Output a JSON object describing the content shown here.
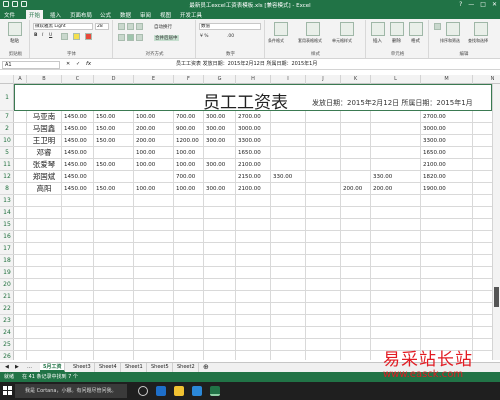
{
  "window": {
    "title": "最新员工excel工资表模板.xls  [兼容模式] - Excel",
    "controls": [
      "?",
      "—",
      "□",
      "✕"
    ]
  },
  "ribbon_tabs": [
    "文件",
    "开始",
    "插入",
    "页面布局",
    "公式",
    "数据",
    "审阅",
    "视图",
    "开发工具"
  ],
  "ribbon": {
    "paste_label": "粘贴",
    "font_name": "微软雅黑 Light",
    "font_size": "28",
    "wrap_text": "自动换行",
    "merge_center": "合并后居中",
    "number_format": "数值",
    "conditional_format": "条件格式",
    "table_format": "套用表格格式",
    "cell_style": "单元格样式",
    "insert": "插入",
    "delete": "删除",
    "format": "格式",
    "sort_filter": "排序和筛选",
    "find_select": "查找和选择",
    "group_clipboard": "剪贴板",
    "group_font": "字体",
    "group_alignment": "对齐方式",
    "group_number": "数字",
    "group_styles": "样式",
    "group_cells": "单元格",
    "group_editing": "编辑"
  },
  "formula_bar": {
    "name_box": "A1",
    "fx": "fx",
    "content": "员工工资表    发放日期：2015年2月12日  所属日期：2015年1月"
  },
  "columns": [
    "A",
    "B",
    "C",
    "D",
    "E",
    "F",
    "G",
    "H",
    "I",
    "J",
    "K",
    "L",
    "M",
    "N"
  ],
  "rows": [
    "1",
    "7",
    "2",
    "10",
    "5",
    "11",
    "12",
    "8",
    "13",
    "14",
    "15",
    "16",
    "17",
    "18",
    "19",
    "20",
    "21",
    "22",
    "23",
    "24",
    "25",
    "26"
  ],
  "sheet_title": {
    "title": "员工工资表",
    "subtitle": "发放日期：2015年2月12日  所属日期：2015年1月"
  },
  "table": [
    {
      "name": "马亚南",
      "c": "1450.00",
      "d": "150.00",
      "e": "100.00",
      "f": "700.00",
      "g": "300.00",
      "h": "2700.00",
      "i": "",
      "j": "",
      "k": "",
      "l": "",
      "m": "2700.00"
    },
    {
      "name": "马国鑫",
      "c": "1450.00",
      "d": "150.00",
      "e": "200.00",
      "f": "900.00",
      "g": "300.00",
      "h": "3000.00",
      "i": "",
      "j": "",
      "k": "",
      "l": "",
      "m": "3000.00"
    },
    {
      "name": "王卫明",
      "c": "1450.00",
      "d": "150.00",
      "e": "200.00",
      "f": "1200.00",
      "g": "300.00",
      "h": "3300.00",
      "i": "",
      "j": "",
      "k": "",
      "l": "",
      "m": "3300.00"
    },
    {
      "name": "邓睿",
      "c": "1450.00",
      "d": "",
      "e": "100.00",
      "f": "100.00",
      "g": "",
      "h": "1650.00",
      "i": "",
      "j": "",
      "k": "",
      "l": "",
      "m": "1650.00"
    },
    {
      "name": "张爱琴",
      "c": "1450.00",
      "d": "150.00",
      "e": "100.00",
      "f": "100.00",
      "g": "300.00",
      "h": "2100.00",
      "i": "",
      "j": "",
      "k": "",
      "l": "",
      "m": "2100.00"
    },
    {
      "name": "郑国斌",
      "c": "1450.00",
      "d": "",
      "e": "",
      "f": "700.00",
      "g": "",
      "h": "2150.00",
      "i": "330.00",
      "j": "",
      "k": "",
      "l": "330.00",
      "m": "1820.00"
    },
    {
      "name": "高阳",
      "c": "1450.00",
      "d": "150.00",
      "e": "100.00",
      "f": "100.00",
      "g": "300.00",
      "h": "2100.00",
      "i": "",
      "j": "",
      "k": "200.00",
      "l": "200.00",
      "m": "1900.00"
    }
  ],
  "sheet_tabs": [
    "5月工资",
    "Sheet3",
    "Sheet4",
    "Sheet1",
    "Sheet5",
    "Sheet2"
  ],
  "status": {
    "ready": "就绪",
    "record": "在 41 条记录中找到 7 个"
  },
  "taskbar": {
    "cortana": "我是 Cortana，小娜。有问题尽管问我。"
  },
  "watermark": {
    "line1": "易采站长站",
    "line2": "www.easck.com"
  },
  "colors": {
    "excel_green": "#217346",
    "watermark_red": "#e21c23"
  }
}
